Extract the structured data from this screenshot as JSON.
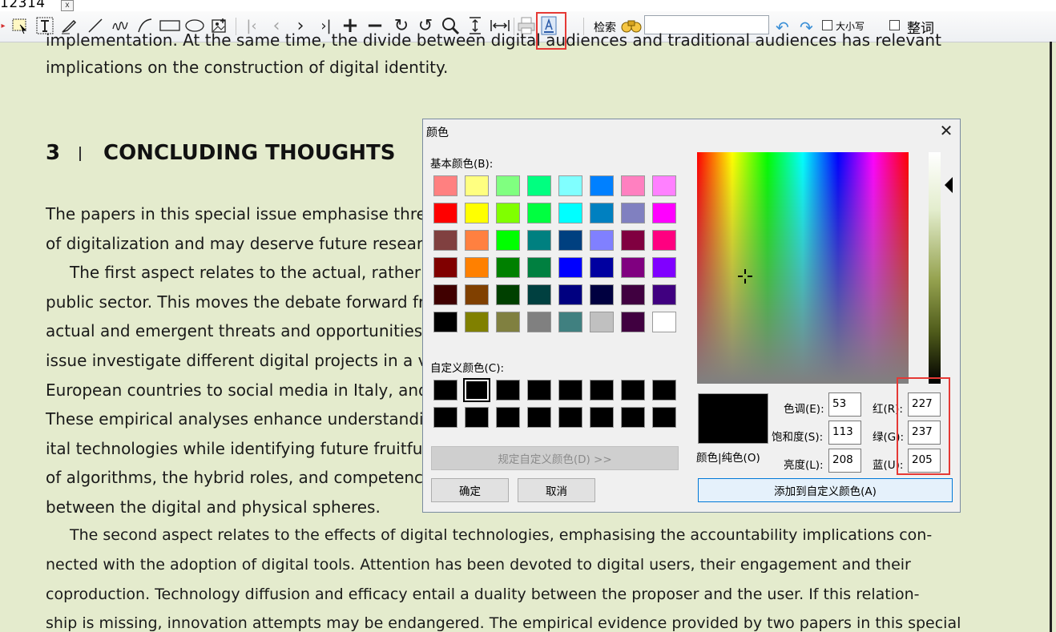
{
  "tab": {
    "label": "12314",
    "close": "x"
  },
  "toolbar": {
    "search_label": "检索",
    "search_value": "",
    "case_label": "大小写",
    "whole_word_label": "整词"
  },
  "document": {
    "lines_top": [
      "implementation. At the same time, the divide between digital audiences and traditional audiences has relevant",
      "implications on the construction of digital identity."
    ],
    "section_number": "3",
    "section_title": "CONCLUDING THOUGHTS",
    "para_lines": [
      "The papers in this special issue emphasise three m",
      "of digitalization and may deserve future research",
      "The first aspect relates to the actual, rather t",
      "public sector. This moves the debate forward fro",
      "actual and emergent threats and opportunities fa",
      "issue investigate different digital projects in a var",
      "European countries to social media in Italy, and t",
      "These empirical analyses enhance understanding",
      "ital technologies while identifying future fruitful",
      "of algorithms, the hybrid roles, and competencie",
      "between the digital and physical spheres."
    ],
    "para2_lines": [
      "The second aspect relates to the effects of digital technologies, emphasising the accountability implications con-",
      "nected with the adoption of digital tools. Attention has been devoted to digital users, their engagement and their",
      "coproduction. Technology diffusion and efficacy entail a duality between the proposer and the user. If this relation-",
      "ship is missing, innovation attempts may be endangered. The empirical evidence provided by two papers in this special"
    ]
  },
  "dialog": {
    "title": "颜色",
    "close": "✕",
    "basic_colors_label": "基本颜色(B):",
    "custom_colors_label": "自定义颜色(C):",
    "define_custom_button": "规定自定义颜色(D) >>",
    "ok_button": "确定",
    "cancel_button": "取消",
    "color_solid_label": "颜色|纯色(O)",
    "hue_label": "色调(E):",
    "hue_value": "53",
    "sat_label": "饱和度(S):",
    "sat_value": "113",
    "lum_label": "亮度(L):",
    "lum_value": "208",
    "red_label": "红(R):",
    "red_value": "227",
    "green_label": "绿(G):",
    "green_value": "237",
    "blue_label": "蓝(U):",
    "blue_value": "205",
    "add_custom_button": "添加到自定义颜色(A)",
    "basic_colors": [
      [
        "#ff8080",
        "#ffff80",
        "#80ff80",
        "#00ff80",
        "#80ffff",
        "#0080ff",
        "#ff80c0",
        "#ff80ff"
      ],
      [
        "#ff0000",
        "#ffff00",
        "#80ff00",
        "#00ff40",
        "#00ffff",
        "#0080c0",
        "#8080c0",
        "#ff00ff"
      ],
      [
        "#804040",
        "#ff8040",
        "#00ff00",
        "#008080",
        "#004080",
        "#8080ff",
        "#800040",
        "#ff0080"
      ],
      [
        "#800000",
        "#ff8000",
        "#008000",
        "#008040",
        "#0000ff",
        "#0000a0",
        "#800080",
        "#8000ff"
      ],
      [
        "#400000",
        "#804000",
        "#004000",
        "#004040",
        "#000080",
        "#000040",
        "#400040",
        "#400080"
      ],
      [
        "#000000",
        "#808000",
        "#808040",
        "#808080",
        "#408080",
        "#c0c0c0",
        "#400040",
        "#ffffff"
      ]
    ],
    "custom_colors": [
      [
        "#000000",
        "#000000",
        "#000000",
        "#000000",
        "#000000",
        "#000000",
        "#000000",
        "#000000"
      ],
      [
        "#000000",
        "#000000",
        "#000000",
        "#000000",
        "#000000",
        "#000000",
        "#000000",
        "#000000"
      ]
    ]
  }
}
